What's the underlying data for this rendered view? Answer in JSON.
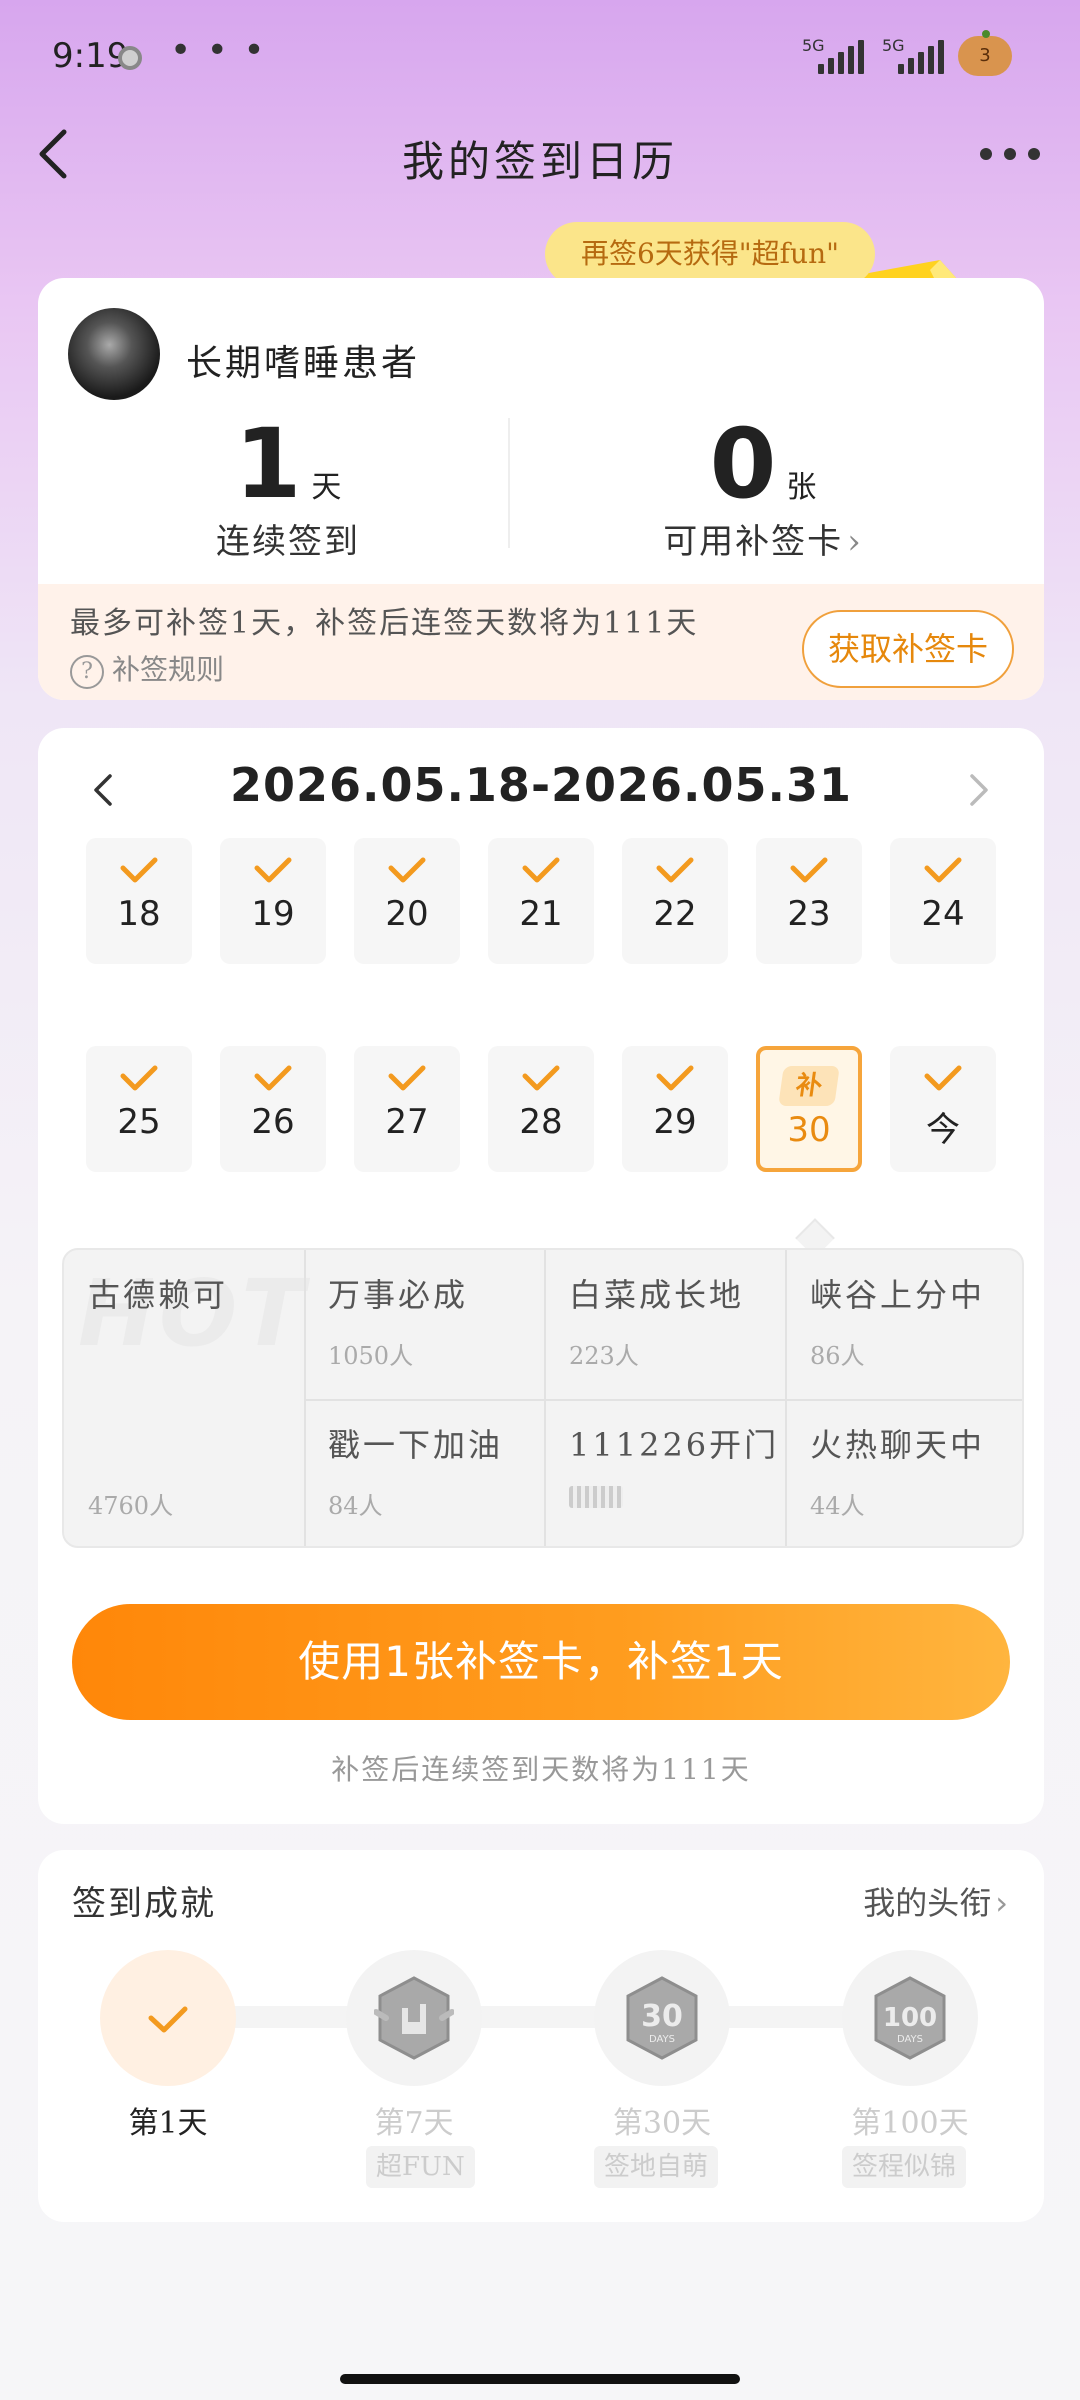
{
  "status_bar": {
    "time": "9:19",
    "more": "• • •",
    "sim1": "5G",
    "sim2": "5G",
    "battery": "3"
  },
  "header": {
    "title": "我的签到日历"
  },
  "promo_bubble": "再签6天获得\"超fun\"",
  "profile": {
    "username": "长期嗜睡患者"
  },
  "stats": {
    "streak_value": "1",
    "streak_unit": "天",
    "streak_label": "连续签到",
    "cards_value": "0",
    "cards_unit": "张",
    "cards_label": "可用补签卡"
  },
  "notice": {
    "text": "最多可补签1天，补签后连签天数将为111天",
    "rules_label": "补签规则",
    "get_card_button": "获取补签卡"
  },
  "calendar": {
    "range": "2026.05.18-2026.05.31",
    "week1": [
      "18",
      "19",
      "20",
      "21",
      "22",
      "23",
      "24"
    ],
    "week2": [
      "25",
      "26",
      "27",
      "28",
      "29",
      "30",
      "今"
    ],
    "makeup_tag": "补"
  },
  "topics": {
    "hot_watermark": "HOT",
    "items": [
      {
        "name": "古德赖可",
        "count": "4760人"
      },
      {
        "name": "万事必成",
        "count": "1050人"
      },
      {
        "name": "白菜成长地",
        "count": "223人"
      },
      {
        "name": "峡谷上分中",
        "count": "86人"
      },
      {
        "name": "戳一下加油",
        "count": "84人"
      },
      {
        "name": "111226开门",
        "count": ""
      },
      {
        "name": "火热聊天中",
        "count": "44人"
      }
    ]
  },
  "use_button": "使用1张补签卡，补签1天",
  "use_hint": "补签后连续签到天数将为111天",
  "achievements": {
    "title": "签到成就",
    "link": "我的头衔",
    "items": [
      {
        "label": "第1天",
        "sub": ""
      },
      {
        "label": "第7天",
        "sub": "超FUN"
      },
      {
        "label": "第30天",
        "sub": "签地自萌"
      },
      {
        "label": "第100天",
        "sub": "签程似锦"
      }
    ]
  },
  "colors": {
    "accent": "#ff8709",
    "accent_text": "#e6880c",
    "check": "#f39a1f"
  }
}
